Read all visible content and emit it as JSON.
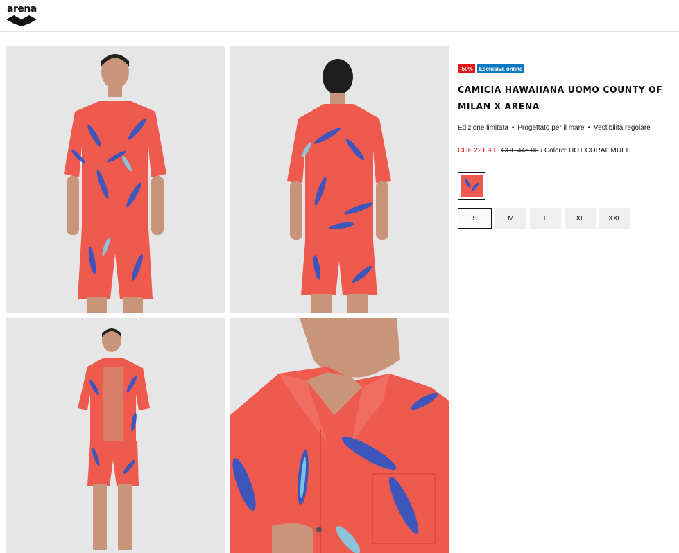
{
  "header": {
    "logo_text": "arena",
    "logo_icon": "arena-diamond-logo-icon"
  },
  "gallery": [
    {
      "alt": "",
      "view": "front"
    },
    {
      "alt": "",
      "view": "back"
    },
    {
      "alt": "",
      "view": "full-body"
    },
    {
      "alt": "",
      "view": "detail"
    }
  ],
  "product": {
    "badges": {
      "sale": "-50%",
      "online": "Esclusiva online"
    },
    "title": "CAMICIA HAWAIIANA UOMO COUNTY OF MILAN X ARENA",
    "features": [
      "Edizione limitata",
      "Progettato per il mare",
      "Vestibilità regolare"
    ],
    "feature_separator": "•",
    "price": {
      "current": "CHF 221.90",
      "original": "CHF 445.00",
      "color_label": "/ Colore: HOT CORAL MULTI"
    },
    "sizes": [
      "S",
      "M",
      "L",
      "XL",
      "XXL"
    ],
    "selected_size": "S"
  },
  "colors": {
    "sale_red": "#e4141b",
    "online_blue": "#0b79c2",
    "shirt_coral": "#ee5a4d",
    "feather_blue": "#2b55c8"
  }
}
